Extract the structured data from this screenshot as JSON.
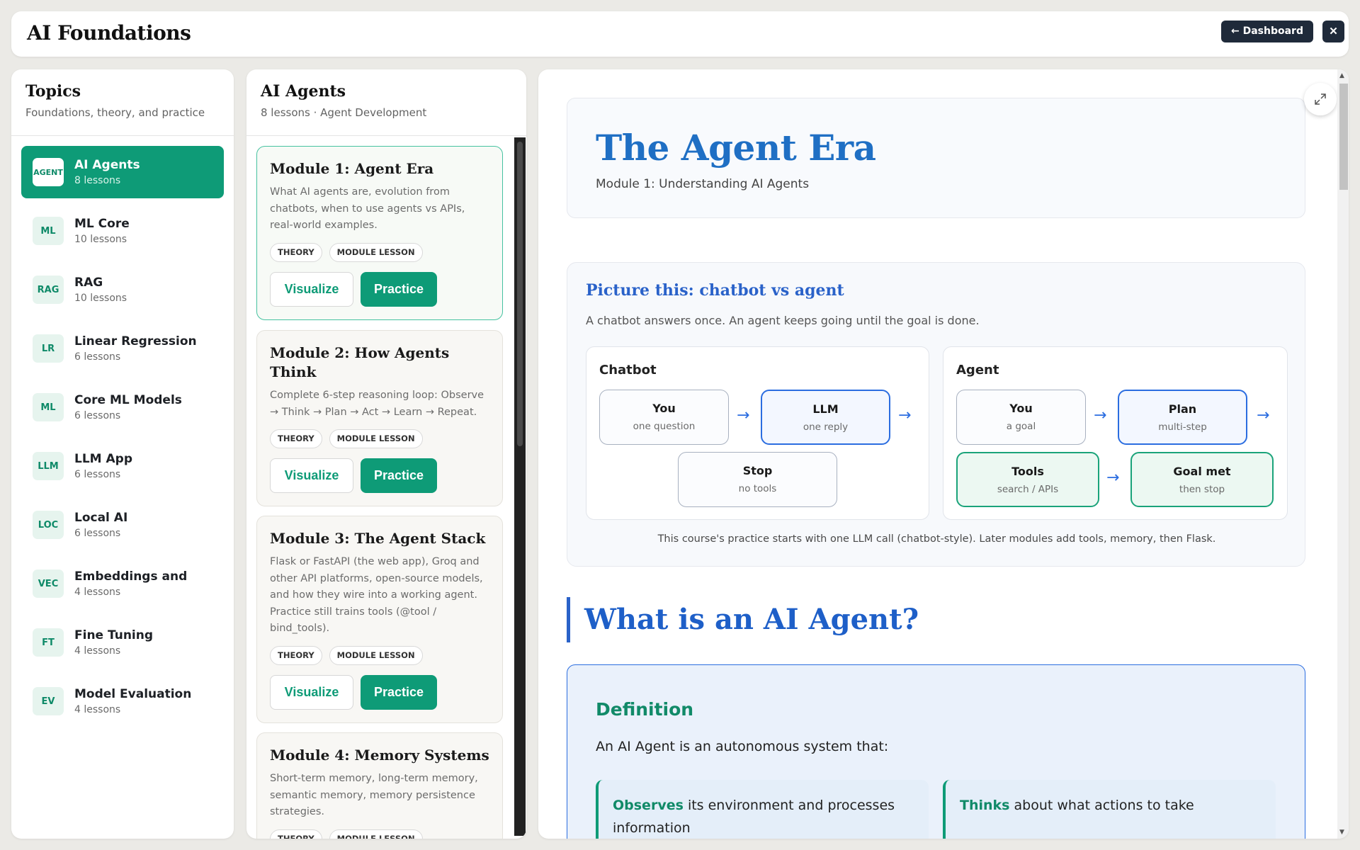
{
  "header": {
    "title": "AI Foundations",
    "dashboard_label": "← Dashboard",
    "close_label": "✕"
  },
  "topics": {
    "title": "Topics",
    "subtitle": "Foundations, theory, and practice",
    "items": [
      {
        "badge": "AGENT",
        "name": "AI Agents",
        "count": "8 lessons"
      },
      {
        "badge": "ML",
        "name": "ML Core",
        "count": "10 lessons"
      },
      {
        "badge": "RAG",
        "name": "RAG",
        "count": "10 lessons"
      },
      {
        "badge": "LR",
        "name": "Linear Regression",
        "count": "6 lessons"
      },
      {
        "badge": "ML",
        "name": "Core ML Models",
        "count": "6 lessons"
      },
      {
        "badge": "LLM",
        "name": "LLM App",
        "count": "6 lessons"
      },
      {
        "badge": "LOC",
        "name": "Local AI",
        "count": "6 lessons"
      },
      {
        "badge": "VEC",
        "name": "Embeddings and",
        "count": "4 lessons"
      },
      {
        "badge": "FT",
        "name": "Fine Tuning",
        "count": "4 lessons"
      },
      {
        "badge": "EV",
        "name": "Model Evaluation",
        "count": "4 lessons"
      }
    ]
  },
  "lessons": {
    "title": "AI Agents",
    "subtitle": "8 lessons · Agent Development",
    "tag_theory": "THEORY",
    "tag_module": "MODULE LESSON",
    "visualize_label": "Visualize",
    "practice_label": "Practice",
    "cards": [
      {
        "title": "Module 1: Agent Era",
        "desc": "What AI agents are, evolution from chatbots, when to use agents vs APIs, real-world examples."
      },
      {
        "title": "Module 2: How Agents Think",
        "desc": "Complete 6-step reasoning loop: Observe → Think → Plan → Act → Learn → Repeat."
      },
      {
        "title": "Module 3: The Agent Stack",
        "desc": "Flask or FastAPI (the web app), Groq and other API platforms, open-source models, and how they wire into a working agent. Practice still trains tools (@tool / bind_tools)."
      },
      {
        "title": "Module 4: Memory Systems",
        "desc": "Short-term memory, long-term memory, semantic memory, memory persistence strategies."
      }
    ]
  },
  "content": {
    "hero_title": "The Agent Era",
    "hero_subtitle": "Module 1: Understanding AI Agents",
    "picture_title": "Picture this: chatbot vs agent",
    "picture_subtitle": "A chatbot answers once. An agent keeps going until the goal is done.",
    "chatbot": {
      "title": "Chatbot",
      "you": "You",
      "you_sub": "one question",
      "llm": "LLM",
      "llm_sub": "one reply",
      "stop": "Stop",
      "stop_sub": "no tools"
    },
    "agent": {
      "title": "Agent",
      "you": "You",
      "you_sub": "a goal",
      "plan": "Plan",
      "plan_sub": "multi-step",
      "tools": "Tools",
      "tools_sub": "search / APIs",
      "goal": "Goal met",
      "goal_sub": "then stop"
    },
    "arrow": "→",
    "picture_note": "This course's practice starts with one LLM call (chatbot-style). Later modules add tools, memory, then Flask.",
    "section_heading": "What is an AI Agent?",
    "definition_title": "Definition",
    "definition_intro": "An AI Agent is an autonomous system that:",
    "def_card_1_strong": "Observes",
    "def_card_1_rest": " its environment and processes information",
    "def_card_2_strong": "Thinks",
    "def_card_2_rest": " about what actions to take"
  },
  "colors": {
    "accent_green": "#0e9b77",
    "accent_blue": "#2b6de0",
    "header_button": "#1f2a3a"
  }
}
